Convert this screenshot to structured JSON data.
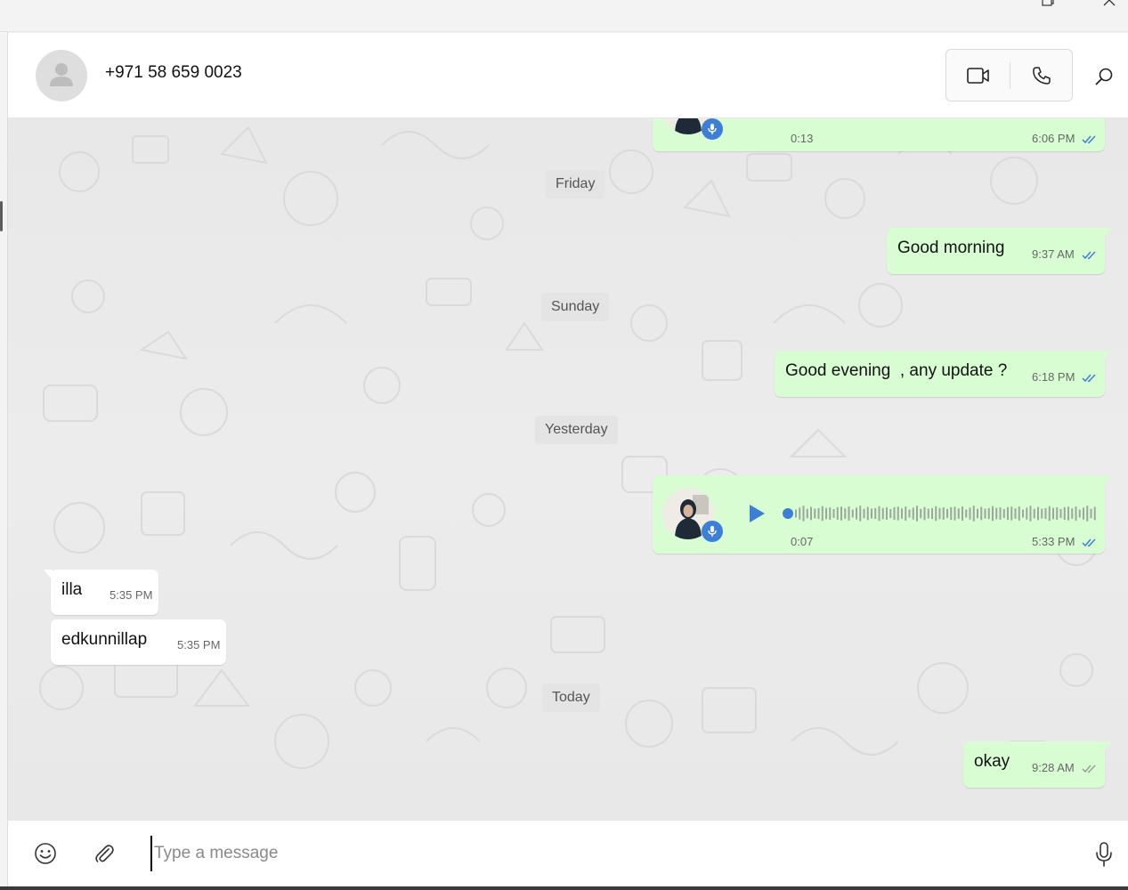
{
  "window": {
    "controls": [
      "restore-icon",
      "close-icon"
    ]
  },
  "header": {
    "contact_name": "+971 58 659 0023",
    "avatar_icon": "person-silhouette-icon",
    "buttons": {
      "video_icon": "video-camera-icon",
      "voice_icon": "phone-icon",
      "search_icon": "search-icon"
    }
  },
  "chat": {
    "day_separators": {
      "friday": "Friday",
      "sunday": "Sunday",
      "yesterday": "Yesterday",
      "today": "Today"
    },
    "voice_note_top": {
      "duration": "0:13",
      "time": "6:06 PM",
      "status": "read"
    },
    "msg_good_morning": {
      "text": "Good morning",
      "time": "9:37 AM",
      "status": "read"
    },
    "msg_good_evening": {
      "text": "Good evening  , any update ?",
      "time": "6:18 PM",
      "status": "read"
    },
    "voice_note_yesterday": {
      "duration": "0:07",
      "time": "5:33 PM",
      "status": "read",
      "progress": 0
    },
    "msg_illa": {
      "text": "illa",
      "time": "5:35 PM"
    },
    "msg_edkunnillap": {
      "text": "edkunnillap",
      "time": "5:35 PM"
    },
    "msg_okay": {
      "text": "okay",
      "time": "9:28 AM",
      "status": "read"
    }
  },
  "composer": {
    "placeholder": "Type a message",
    "value": "",
    "emoji_icon": "emoji-icon",
    "attach_icon": "paperclip-icon",
    "mic_icon": "microphone-icon"
  },
  "colors": {
    "outgoing_bubble": "#d9fdd3",
    "incoming_bubble": "#ffffff",
    "read_ticks": "#3d7fd6",
    "play_button": "#3d7fd6",
    "chat_background": "#e8e8e8"
  }
}
